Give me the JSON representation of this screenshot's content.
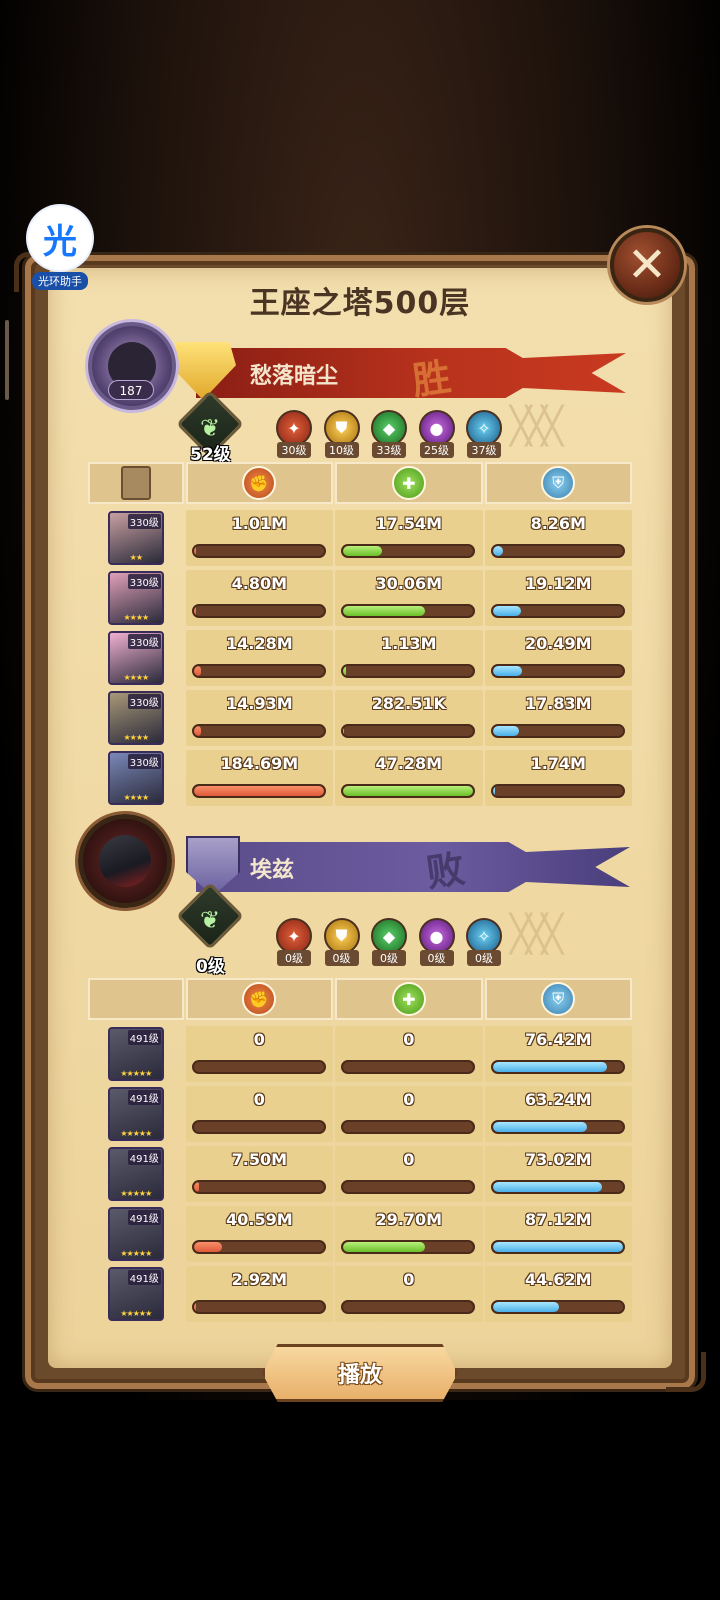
{
  "watermark": {
    "glyph": "光",
    "text": "光环助手"
  },
  "title": "王座之塔500层",
  "close_icon": "close-icon",
  "colors": {
    "damage": "#e05a3a",
    "heal": "#6ac02a",
    "tank": "#4ab0e8",
    "parchment": "#f0d9a4"
  },
  "team1": {
    "name": "愁落暗尘",
    "result": "胜",
    "avatar_level": "187",
    "tree_level": "52级",
    "factions": [
      {
        "icon": "lightbearer-icon",
        "level": "30级"
      },
      {
        "icon": "mauler-icon",
        "level": "10级"
      },
      {
        "icon": "wilder-icon",
        "level": "33级"
      },
      {
        "icon": "graveborn-icon",
        "level": "25级"
      },
      {
        "icon": "celestial-icon",
        "level": "37级"
      }
    ],
    "heroes": [
      {
        "level": "330级",
        "stars": "★★",
        "damage": "1.01M",
        "heal": "17.54M",
        "tank": "8.26M",
        "damage_fill": 0.02,
        "heal_fill": 0.3,
        "tank_fill": 0.08
      },
      {
        "level": "330级",
        "stars": "★★★★",
        "damage": "4.80M",
        "heal": "30.06M",
        "tank": "19.12M",
        "damage_fill": 0.02,
        "heal_fill": 0.63,
        "tank_fill": 0.22
      },
      {
        "level": "330级",
        "stars": "★★★★",
        "damage": "14.28M",
        "heal": "1.13M",
        "tank": "20.49M",
        "damage_fill": 0.06,
        "heal_fill": 0.02,
        "tank_fill": 0.23
      },
      {
        "level": "330级",
        "stars": "★★★★",
        "damage": "14.93M",
        "heal": "282.51K",
        "tank": "17.83M",
        "damage_fill": 0.06,
        "heal_fill": 0.005,
        "tank_fill": 0.2
      },
      {
        "level": "330级",
        "stars": "★★★★",
        "damage": "184.69M",
        "heal": "47.28M",
        "tank": "1.74M",
        "damage_fill": 1.0,
        "heal_fill": 1.0,
        "tank_fill": 0.02
      }
    ]
  },
  "team2": {
    "name": "埃兹",
    "result": "败",
    "tree_level": "0级",
    "factions": [
      {
        "icon": "lightbearer-icon",
        "level": "0级"
      },
      {
        "icon": "mauler-icon",
        "level": "0级"
      },
      {
        "icon": "wilder-icon",
        "level": "0级"
      },
      {
        "icon": "graveborn-icon",
        "level": "0级"
      },
      {
        "icon": "celestial-icon",
        "level": "0级"
      }
    ],
    "heroes": [
      {
        "level": "491级",
        "stars": "★★★★★",
        "damage": "0",
        "heal": "0",
        "tank": "76.42M",
        "damage_fill": 0,
        "heal_fill": 0,
        "tank_fill": 0.88
      },
      {
        "level": "491级",
        "stars": "★★★★★",
        "damage": "0",
        "heal": "0",
        "tank": "63.24M",
        "damage_fill": 0,
        "heal_fill": 0,
        "tank_fill": 0.73
      },
      {
        "level": "491级",
        "stars": "★★★★★",
        "damage": "7.50M",
        "heal": "0",
        "tank": "73.02M",
        "damage_fill": 0.04,
        "heal_fill": 0,
        "tank_fill": 0.84
      },
      {
        "level": "491级",
        "stars": "★★★★★",
        "damage": "40.59M",
        "heal": "29.70M",
        "tank": "87.12M",
        "damage_fill": 0.22,
        "heal_fill": 0.63,
        "tank_fill": 1.0
      },
      {
        "level": "491级",
        "stars": "★★★★★",
        "damage": "2.92M",
        "heal": "0",
        "tank": "44.62M",
        "damage_fill": 0.02,
        "heal_fill": 0,
        "tank_fill": 0.51
      }
    ]
  },
  "columns": {
    "damage_icon": "damage-icon",
    "heal_icon": "heal-icon",
    "tank_icon": "shield-icon"
  },
  "play_button": "播放"
}
